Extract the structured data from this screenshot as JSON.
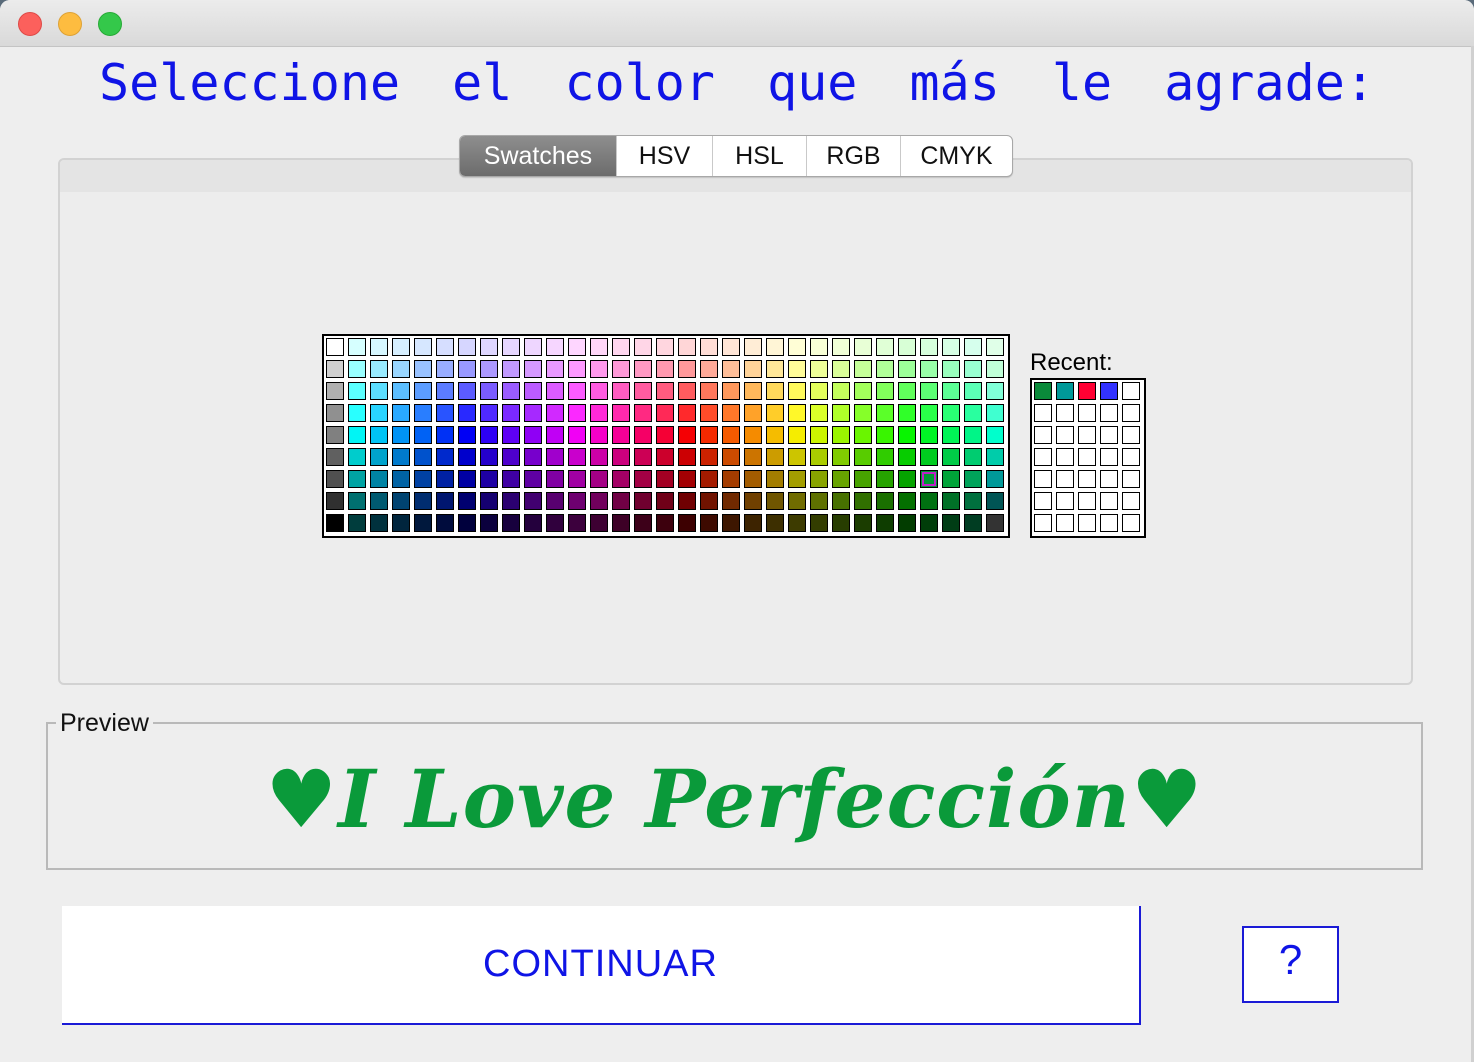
{
  "window": {
    "controls": [
      "close",
      "minimize",
      "maximize"
    ]
  },
  "heading": "Seleccione el color que más le agrade:",
  "tabs": [
    {
      "label": "Swatches",
      "active": true
    },
    {
      "label": "HSV",
      "active": false
    },
    {
      "label": "HSL",
      "active": false
    },
    {
      "label": "RGB",
      "active": false
    },
    {
      "label": "CMYK",
      "active": false
    }
  ],
  "recent": {
    "label": "Recent:",
    "colors": [
      "#0a8a3a",
      "#009999",
      "#ff0033",
      "#3333ff"
    ]
  },
  "selected_color": "#009933",
  "preview": {
    "legend": "Preview",
    "text": "♥I Love Perfección♥",
    "color": "#0a9a3a"
  },
  "buttons": {
    "continue_label": "CONTINUAR",
    "help_label": "?"
  },
  "accent_color": "#0f14e6"
}
